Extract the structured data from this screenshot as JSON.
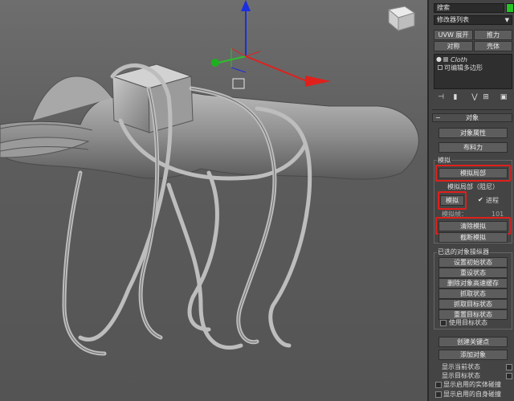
{
  "command_panel": {
    "search_text": "搜索",
    "modifier_list_label": "修改器列表",
    "buttons_row1": [
      "UVW 展开",
      "推力"
    ],
    "buttons_row2": [
      "对称",
      "壳体"
    ],
    "stack_items": [
      "Cloth",
      "可编辑多边形"
    ],
    "stack_tools": [
      "pin-stack-icon",
      "show-end-result-icon",
      "make-unique-icon",
      "remove-modifier-icon",
      "configure-icon"
    ]
  },
  "object_rollout": {
    "header": "对象",
    "object_properties": "对象属性",
    "cloth_forces": "布料力",
    "simulate_group_label": "模拟",
    "simulate_local": "模拟局部",
    "simulate_local_damped": "模拟局部（阻尼）",
    "simulate": "模拟",
    "progress_label": "进程",
    "sim_frame_label": "模拟帧：",
    "sim_frame_value": "101",
    "erase_simulation": "清除模拟",
    "truncate_simulation": "截断模拟"
  },
  "selected_object": {
    "group_label": "已选的对象操纵器",
    "buttons": [
      "设置初始状态",
      "重设状态",
      "删除对象高速缓存",
      "抓取状态",
      "抓取目标状态",
      "重置目标状态"
    ],
    "use_target_state": "使用目标状态"
  },
  "bottom": {
    "create_keyframe": "创建关键点",
    "add_object": "添加对象",
    "checks": [
      "显示当前状态",
      "显示目标状态",
      "显示启用的实体碰撞",
      "显示启用的自身碰撞"
    ]
  },
  "colors": {
    "highlight": "#e0201c",
    "x_axis": "#e0201c",
    "y_axis": "#2bbf2b",
    "z_axis": "#1a2fe0",
    "active_green": "#27c427"
  }
}
